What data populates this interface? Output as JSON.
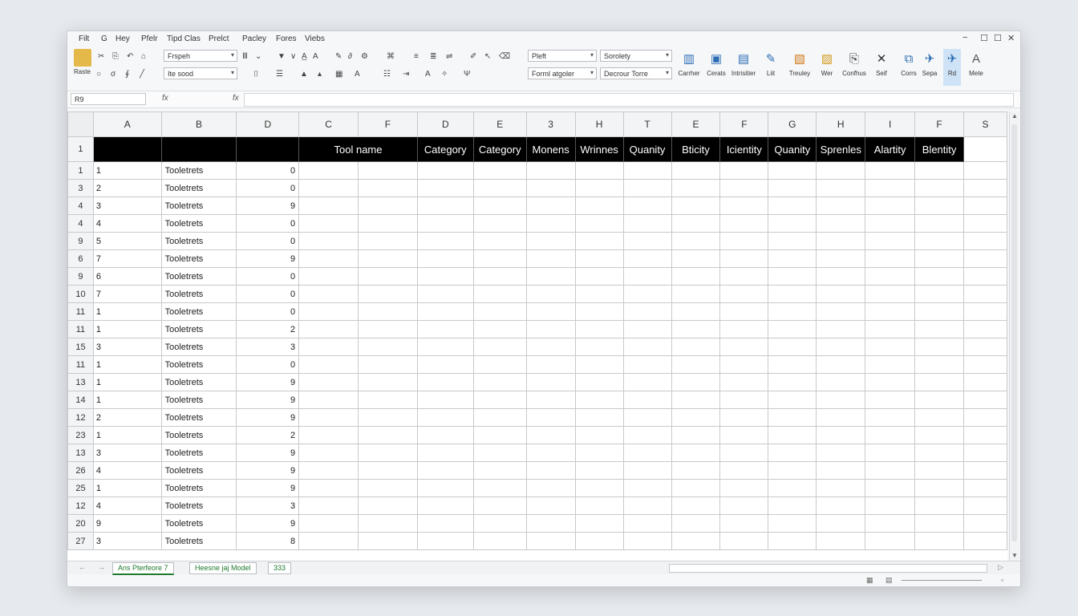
{
  "menu": [
    "Filt",
    "G",
    "Hey",
    "Pfelr",
    "Tipd Clas",
    "Prelct",
    "Pacley",
    "Fores",
    "Viebs"
  ],
  "window_controls": [
    "−",
    "☐",
    "☐",
    "✕"
  ],
  "ribbon": {
    "paste_label": "Raste",
    "font_combo": "Frspeh",
    "font_combo2": "Ite sood",
    "style_combo": "Pleft",
    "format_combo": "Sorolety",
    "cond_format_btn": "Forml atgoler",
    "table_btn": "Decrour Torre",
    "big_tools": [
      "Carrher",
      "Cerats",
      "Intrisitier",
      "Liit",
      "Treuley",
      "Wer",
      "Confhus",
      "Seif",
      "Corrs",
      "Sepa",
      "Rd",
      "Mete"
    ]
  },
  "formula_bar": {
    "name_box": "R9",
    "name_box_fx": "fx",
    "fx_end": "fx"
  },
  "columns": [
    "A",
    "B",
    "D",
    "C",
    "F",
    "D",
    "E",
    "3",
    "H",
    "T",
    "E",
    "F",
    "G",
    "H",
    "I",
    "F",
    "S"
  ],
  "header_row": {
    "row_label": "1",
    "cells": [
      "",
      "",
      "",
      "Tool name",
      "",
      "Category",
      "Category",
      "Monens",
      "Wrinnes",
      "Quanity",
      "Bticity",
      "Icientity",
      "Quanity",
      "Sprenles",
      "Alartity",
      "Blentity",
      ""
    ]
  },
  "rows": [
    {
      "n": "1",
      "a": "1",
      "b": "Tooletrets",
      "d": "0"
    },
    {
      "n": "3",
      "a": "2",
      "b": "Tooletrets",
      "d": "0"
    },
    {
      "n": "4",
      "a": "3",
      "b": "Tooletrets",
      "d": "9"
    },
    {
      "n": "4",
      "a": "4",
      "b": "Tooletrets",
      "d": "0"
    },
    {
      "n": "9",
      "a": "5",
      "b": "Tooletrets",
      "d": "0"
    },
    {
      "n": "6",
      "a": "7",
      "b": "Tooletrets",
      "d": "9"
    },
    {
      "n": "9",
      "a": "6",
      "b": "Tooletrets",
      "d": "0"
    },
    {
      "n": "10",
      "a": "7",
      "b": "Tooletrets",
      "d": "0"
    },
    {
      "n": "11",
      "a": "1",
      "b": "Tooletrets",
      "d": "0"
    },
    {
      "n": "11",
      "a": "1",
      "b": "Tooletrets",
      "d": "2"
    },
    {
      "n": "15",
      "a": "3",
      "b": "Tooletrets",
      "d": "3"
    },
    {
      "n": "11",
      "a": "1",
      "b": "Tooletrets",
      "d": "0"
    },
    {
      "n": "13",
      "a": "1",
      "b": "Tooletrets",
      "d": "9"
    },
    {
      "n": "14",
      "a": "1",
      "b": "Tooletrets",
      "d": "9"
    },
    {
      "n": "12",
      "a": "2",
      "b": "Tooletrets",
      "d": "9"
    },
    {
      "n": "23",
      "a": "1",
      "b": "Tooletrets",
      "d": "2"
    },
    {
      "n": "13",
      "a": "3",
      "b": "Tooletrets",
      "d": "9"
    },
    {
      "n": "26",
      "a": "4",
      "b": "Tooletrets",
      "d": "9"
    },
    {
      "n": "25",
      "a": "1",
      "b": "Tooletrets",
      "d": "9"
    },
    {
      "n": "12",
      "a": "4",
      "b": "Tooletrets",
      "d": "3"
    },
    {
      "n": "20",
      "a": "9",
      "b": "Tooletrets",
      "d": "9"
    },
    {
      "n": "27",
      "a": "3",
      "b": "Tooletrets",
      "d": "8"
    }
  ],
  "sheet_tabs": [
    "Ans Pterfeore 7",
    "Heesne jaj Model",
    "333"
  ],
  "nav_arrows": [
    "←",
    "→"
  ]
}
